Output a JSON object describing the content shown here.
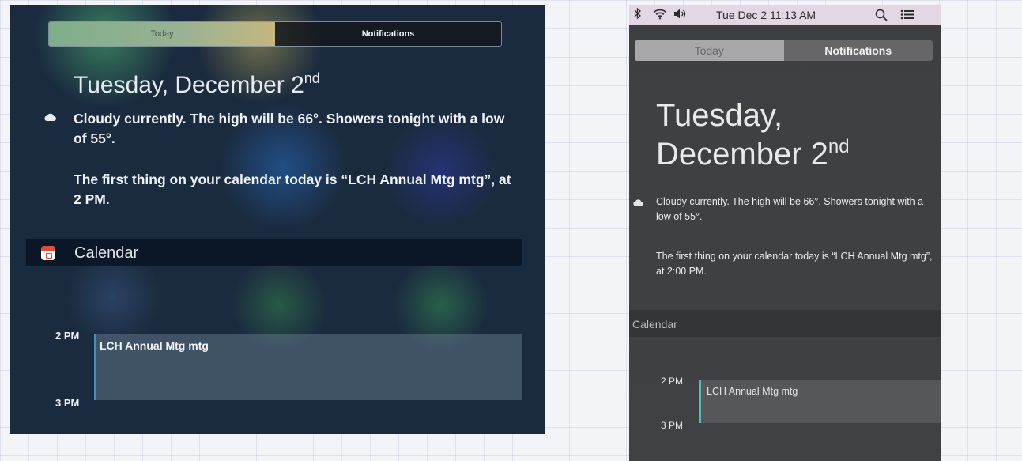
{
  "ios": {
    "tabs": {
      "today": "Today",
      "notifications": "Notifications"
    },
    "date": {
      "main": "Tuesday, December 2",
      "suffix": "nd"
    },
    "weather_icon": "cloud-icon",
    "weather_text": "Cloudy currently. The high will be 66°. Showers tonight with a low of 55°.",
    "calendar_text": "The first thing on your calendar today is “LCH Annual Mtg mtg”, at 2 PM.",
    "calendar_section": {
      "icon": "calendar-icon",
      "label": "Calendar"
    },
    "times": {
      "start": "2 PM",
      "end": "3 PM"
    },
    "event": "LCH Annual Mtg mtg"
  },
  "mac": {
    "menubar": {
      "icons": [
        "bluetooth-icon",
        "wifi-icon",
        "volume-icon",
        "search-icon",
        "list-icon"
      ],
      "clock": "Tue Dec 2  11:13 AM"
    },
    "tabs": {
      "today": "Today",
      "notifications": "Notifications"
    },
    "date": {
      "line1": "Tuesday,",
      "line2": "December 2",
      "suffix": "nd"
    },
    "weather_icon": "cloud-icon",
    "weather_text": "Cloudy currently. The high will be 66°. Showers tonight with a low of 55°.",
    "calendar_text": "The first thing on your calendar today is “LCH Annual Mtg mtg”, at 2:00 PM.",
    "calendar_section": {
      "label": "Calendar"
    },
    "times": {
      "start": "2 PM",
      "end": "3 PM"
    },
    "event": "LCH Annual Mtg mtg"
  }
}
